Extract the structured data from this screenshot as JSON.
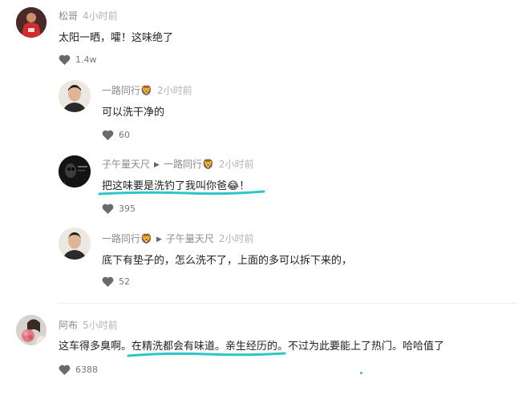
{
  "colors": {
    "highlight": "#2cc6c6",
    "heart": "#6a6a6a",
    "username": "#8a8a8a",
    "time": "#b3b3b3"
  },
  "comments": [
    {
      "user": "松哥",
      "time": "4小时前",
      "text": "太阳一晒，嚯！这味绝了",
      "likes": "1.4w",
      "avatar_icon": "red-jersey-avatar"
    },
    {
      "user": "一路同行🦁",
      "time": "2小时前",
      "text": "可以洗干净的",
      "likes": "60",
      "avatar_icon": "man-portrait-avatar"
    },
    {
      "user": "子午量天尺",
      "reply_to": "一路同行🦁",
      "time": "2小时前",
      "text": "把这味要是洗钓了我叫你爸😂！",
      "likes": "395",
      "avatar_icon": "dark-skull-avatar"
    },
    {
      "user": "一路同行🦁",
      "reply_to": "子午量天尺",
      "time": "2小时前",
      "text": "底下有垫子的，怎么洗不了，上面的多可以拆下来的，",
      "likes": "52",
      "avatar_icon": "man-portrait-avatar"
    },
    {
      "user": "阿布",
      "time": "5小时前",
      "text": "这车得多臭啊。在精洗都会有味道。亲生经历的。不过为此要能上了热门。哈哈值了",
      "likes": "6388",
      "avatar_icon": "woman-flowers-avatar"
    }
  ]
}
